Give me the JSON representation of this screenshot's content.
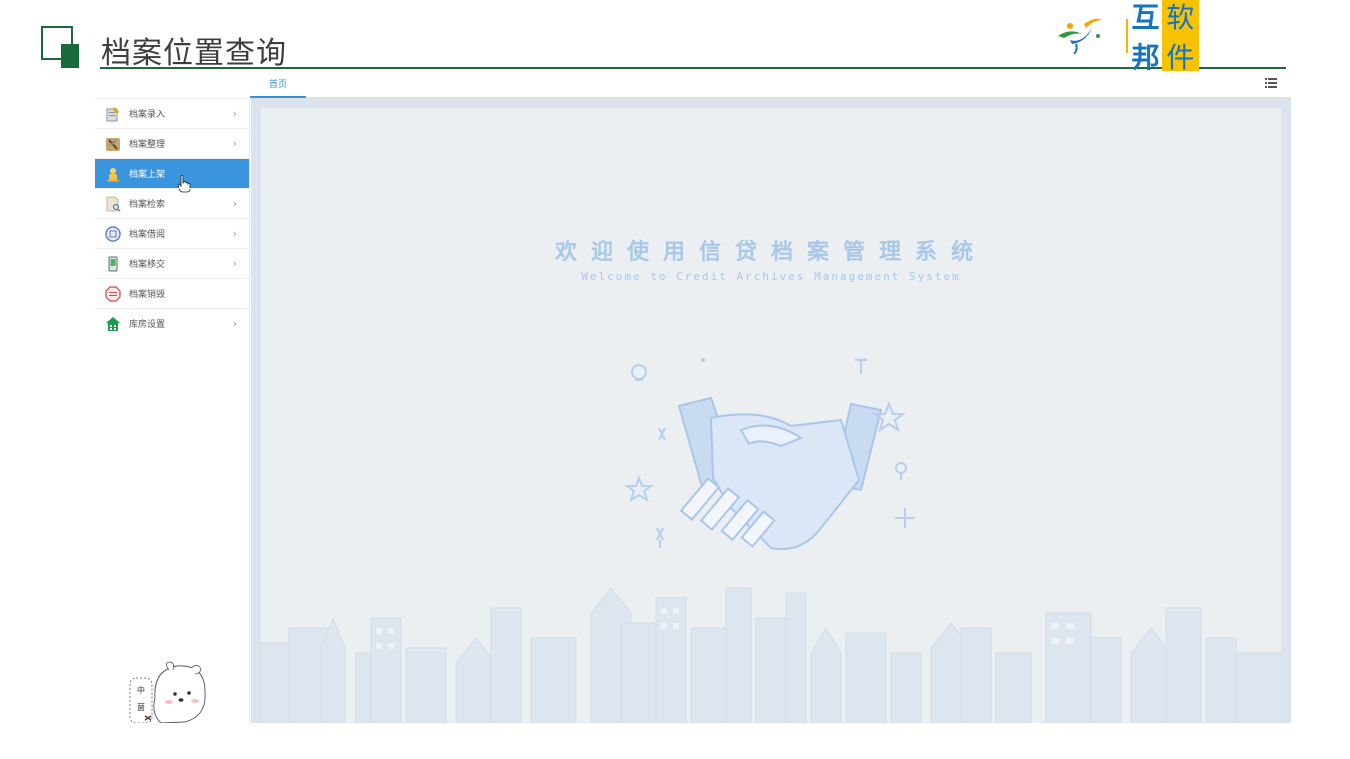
{
  "slide": {
    "title": "档案位置查询",
    "logo_text_a": "互邦",
    "logo_text_b": "软件"
  },
  "tabs": [
    {
      "label": "首页",
      "active": true
    }
  ],
  "sidebar": {
    "items": [
      {
        "label": "档案录入",
        "icon": "document-edit-icon",
        "has_arrow": true,
        "active": false
      },
      {
        "label": "档案整理",
        "icon": "tools-icon",
        "has_arrow": true,
        "active": false
      },
      {
        "label": "档案上架",
        "icon": "shelf-person-icon",
        "has_arrow": false,
        "active": true
      },
      {
        "label": "档案检索",
        "icon": "document-search-icon",
        "has_arrow": true,
        "active": false
      },
      {
        "label": "档案借阅",
        "icon": "borrow-badge-icon",
        "has_arrow": true,
        "active": false
      },
      {
        "label": "档案移交",
        "icon": "phone-transfer-icon",
        "has_arrow": true,
        "active": false
      },
      {
        "label": "档案销毁",
        "icon": "destroy-stamp-icon",
        "has_arrow": false,
        "active": false
      },
      {
        "label": "库房设置",
        "icon": "warehouse-icon",
        "has_arrow": true,
        "active": false
      }
    ],
    "chevron": "›",
    "mascot_text": [
      "中",
      "菌"
    ]
  },
  "welcome": {
    "title_cn": "欢迎使用信贷档案管理系统",
    "title_en": "Welcome to Credit Archives Management System"
  },
  "colors": {
    "brand_green": "#1c6a3b",
    "active_blue": "#3b95de",
    "welcome_text": "#a9c8e8",
    "content_bg": "#ebeff2"
  }
}
